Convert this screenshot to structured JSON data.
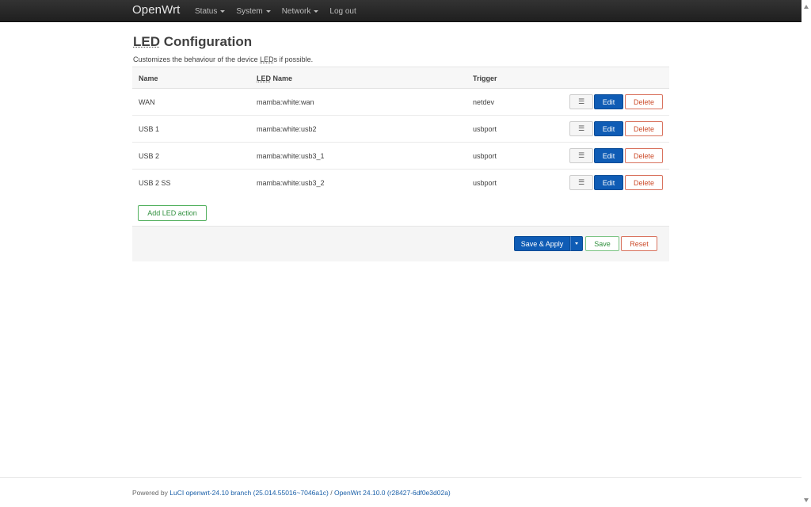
{
  "navbar": {
    "brand": "OpenWrt",
    "menu": [
      {
        "label": "Status"
      },
      {
        "label": "System"
      },
      {
        "label": "Network"
      },
      {
        "label": "Log out"
      }
    ]
  },
  "page": {
    "title_abbr": "LED",
    "title_rest": " Configuration",
    "desc_before": "Customizes the behaviour of the device ",
    "desc_abbr": "LED",
    "desc_after": "s if possible."
  },
  "table": {
    "headers": {
      "name": "Name",
      "led_abbr": "LED",
      "led_rest": " Name",
      "trigger": "Trigger"
    },
    "rows": [
      {
        "name": "WAN",
        "led": "mamba:white:wan",
        "trigger": "netdev"
      },
      {
        "name": "USB 1",
        "led": "mamba:white:usb2",
        "trigger": "usbport"
      },
      {
        "name": "USB 2",
        "led": "mamba:white:usb3_1",
        "trigger": "usbport"
      },
      {
        "name": "USB 2 SS",
        "led": "mamba:white:usb3_2",
        "trigger": "usbport"
      }
    ],
    "row_buttons": {
      "drag": "☰",
      "edit": "Edit",
      "delete": "Delete"
    }
  },
  "add_button": "Add LED action",
  "actions": {
    "save_apply": "Save & Apply",
    "save": "Save",
    "reset": "Reset"
  },
  "footer": {
    "prefix": "Powered by ",
    "luci": "LuCI openwrt-24.10 branch (25.014.55016~7046a1c)",
    "sep": " / ",
    "openwrt": "OpenWrt 24.10.0 (r28427-6df0e3d02a)"
  },
  "colors": {
    "primary": "#0f5cb5",
    "positive": "#2f8f3c",
    "negative": "#cc4b2a",
    "navbar": "#2a2a2a"
  }
}
